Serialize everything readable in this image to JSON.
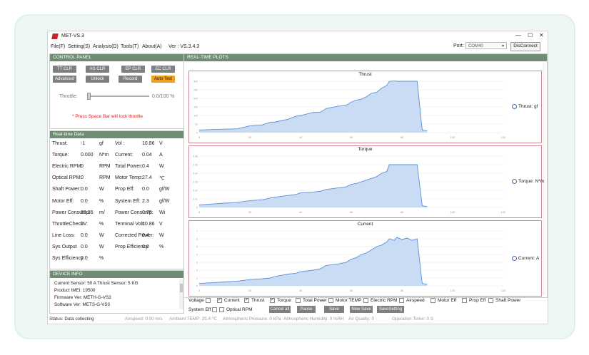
{
  "window": {
    "title": "MET-VS.3",
    "minimize": "—",
    "maximize": "☐",
    "close": "✕"
  },
  "menu": [
    "File(F)",
    "Setting(S)",
    "Analysis(D)",
    "Tools(T)",
    "About(A)"
  ],
  "version": "Ver : VS.3.4.3",
  "port": {
    "label": "Port:",
    "value": "COM40",
    "connect_btn": "DisConnect"
  },
  "control_panel": {
    "title": "CONTROL PANEL",
    "buttons": [
      "TT CLR",
      "AS CLR",
      "EP CLR",
      "EC CLR",
      "Advanced",
      "Unlock",
      "Record",
      "Auto Test"
    ],
    "throttle_label": "Throttle:",
    "throttle_value": "0.0/100 %",
    "throttle_level": 0,
    "warning": "* Press Space Bar will lock throttle"
  },
  "realtime": {
    "title": "Real-time Data",
    "rows": [
      [
        "Thrust:",
        "-1",
        "gf",
        "Vol :",
        "10.86",
        "V"
      ],
      [
        "Torque:",
        "0.000",
        "N*m",
        "Current:",
        "0.04",
        "A"
      ],
      [
        "Electric RPM:",
        "0",
        "RPM",
        "Total Power:",
        "0.4",
        "W"
      ],
      [
        "Optical RPM:",
        "0",
        "RPM",
        "Motor Temp:",
        "27.4",
        "℃"
      ],
      [
        "Shaft Power:",
        "0.0",
        "W",
        "Prop Eff:",
        "0.0",
        "gf/W"
      ],
      [
        "Motor Eff:",
        "0.0",
        "%",
        "System Eff:",
        "2.3",
        "gf/W"
      ],
      [
        "Power Consump:",
        "69.36",
        "m/",
        "Power Consump:",
        "0.75",
        "Wi"
      ],
      [
        "ThrottleCheckV:",
        "0",
        "%",
        "Terminal Volt:",
        "10.86",
        "V"
      ],
      [
        "Line Loss:",
        "0.0",
        "W",
        "Corrected Power:",
        "0.4",
        "W"
      ],
      [
        "Sys Output",
        "0.0",
        "W",
        "Prop Efficiency",
        "0.0",
        "%"
      ],
      [
        "Sys Efficiency",
        "0.0",
        "%",
        "",
        "",
        ""
      ]
    ]
  },
  "device_info": {
    "title": "DEVICE INFO",
    "lines": [
      "Current Sensor:  50   A          Thrust Sensor:  5   KG",
      "Product IMEI:    19500",
      "Firmware Ver:    METH-G-VS3",
      "Software Ver:    METS-G-VS3"
    ]
  },
  "plots": {
    "title": "REAL-TIME PLOTS",
    "charts_label": "REAL-TIME PLOTS"
  },
  "chart_data": [
    {
      "type": "area",
      "title": "Thrust",
      "series": [
        {
          "name": "Thrust: gf",
          "x": [
            0,
            5,
            10,
            15,
            20,
            25,
            28,
            30,
            35,
            38,
            40,
            45,
            48,
            50,
            55,
            58,
            60,
            62,
            64,
            66,
            68,
            70,
            72,
            74,
            75,
            77,
            78,
            80,
            82,
            84,
            86,
            88,
            90
          ],
          "y": [
            15,
            18,
            20,
            22,
            40,
            45,
            60,
            62,
            78,
            95,
            100,
            118,
            120,
            140,
            155,
            160,
            178,
            190,
            195,
            210,
            230,
            235,
            260,
            275,
            300,
            302,
            300,
            300,
            300,
            300,
            300,
            15,
            10
          ]
        }
      ],
      "xlim": [
        0,
        120
      ],
      "ylim": [
        0,
        300
      ],
      "xticks": [
        0,
        20,
        40,
        60,
        80,
        100,
        120
      ],
      "yticks": [
        0,
        50,
        100,
        150,
        200,
        250,
        300
      ]
    },
    {
      "type": "area",
      "title": "Torque",
      "series": [
        {
          "name": "Torque: N*m",
          "x": [
            0,
            5,
            10,
            15,
            20,
            25,
            28,
            30,
            35,
            38,
            40,
            45,
            48,
            50,
            55,
            58,
            60,
            62,
            64,
            66,
            68,
            70,
            72,
            74,
            75,
            77,
            78,
            80,
            82,
            84,
            86,
            88,
            90
          ],
          "y": [
            0.003,
            0.004,
            0.005,
            0.006,
            0.008,
            0.009,
            0.011,
            0.012,
            0.014,
            0.015,
            0.017,
            0.018,
            0.019,
            0.021,
            0.023,
            0.024,
            0.027,
            0.028,
            0.03,
            0.032,
            0.034,
            0.036,
            0.04,
            0.042,
            0.05,
            0.05,
            0.05,
            0.05,
            0.05,
            0.05,
            0.05,
            0.002,
            0.001
          ]
        }
      ],
      "xlim": [
        0,
        120
      ],
      "ylim": [
        0,
        0.06
      ],
      "xticks": [
        0,
        20,
        40,
        60,
        80,
        100,
        120
      ],
      "yticks": [
        0,
        0.01,
        0.02,
        0.03,
        0.04,
        0.05,
        0.06
      ]
    },
    {
      "type": "area",
      "title": "Current",
      "series": [
        {
          "name": "Current: A",
          "x": [
            0,
            5,
            10,
            15,
            20,
            25,
            28,
            30,
            35,
            38,
            40,
            45,
            48,
            50,
            55,
            58,
            60,
            62,
            64,
            66,
            68,
            70,
            72,
            74,
            75,
            77,
            78,
            80,
            82,
            84,
            86,
            88,
            90
          ],
          "y": [
            0.3,
            0.4,
            0.5,
            0.6,
            0.8,
            0.9,
            1.0,
            1.2,
            1.5,
            1.6,
            1.8,
            2.0,
            2.2,
            2.6,
            2.8,
            3.0,
            3.4,
            3.6,
            4.0,
            4.2,
            4.6,
            5.0,
            5.2,
            5.6,
            6.0,
            5.8,
            6.2,
            5.9,
            6.1,
            5.8,
            6.0,
            0.3,
            0.2
          ]
        }
      ],
      "xlim": [
        0,
        120
      ],
      "ylim": [
        0,
        7
      ],
      "xticks": [
        0,
        20,
        40,
        60,
        80,
        100,
        120
      ],
      "yticks": [
        0,
        1,
        2,
        3,
        4,
        5,
        6,
        7
      ]
    }
  ],
  "plot_controls": {
    "checkboxes": [
      {
        "label": "Voltage",
        "checked": false
      },
      {
        "label": "Current",
        "checked": true
      },
      {
        "label": "Thrust",
        "checked": true
      },
      {
        "label": "Torque",
        "checked": true
      },
      {
        "label": "Total Power",
        "checked": false
      },
      {
        "label": "Motor TEMP",
        "checked": false
      },
      {
        "label": "Electric RPM",
        "checked": false
      },
      {
        "label": "Airspeed",
        "checked": false
      },
      {
        "label": "Motor Eff",
        "checked": false
      },
      {
        "label": "Prop Eff",
        "checked": false
      },
      {
        "label": "Shaft Power",
        "checked": false
      },
      {
        "label": "System Eff",
        "checked": false
      },
      {
        "label": "Optical RPM",
        "checked": false
      }
    ],
    "buttons": [
      "Cancel all",
      "Pause",
      "Save",
      "New Save",
      "SaveSetting"
    ]
  },
  "status": {
    "status": "Status:  Data collecting",
    "airspeed": "Airspeed:  0.00  m/s",
    "ambient": "Ambient TEMP:  25.4  ℃",
    "pressure": "Atmospheric Pressure:  0  kPa",
    "humidity": "Atmospheric Humidity:  0  %RH",
    "air_quality": "Air Quality:  0",
    "op_timer": "Operation Timer:  0  S"
  },
  "colors": {
    "header": "#6f8d73",
    "accent": "#f0a020",
    "plot_line": "#5b8fd6",
    "plot_fill": "#c9dcf3"
  }
}
